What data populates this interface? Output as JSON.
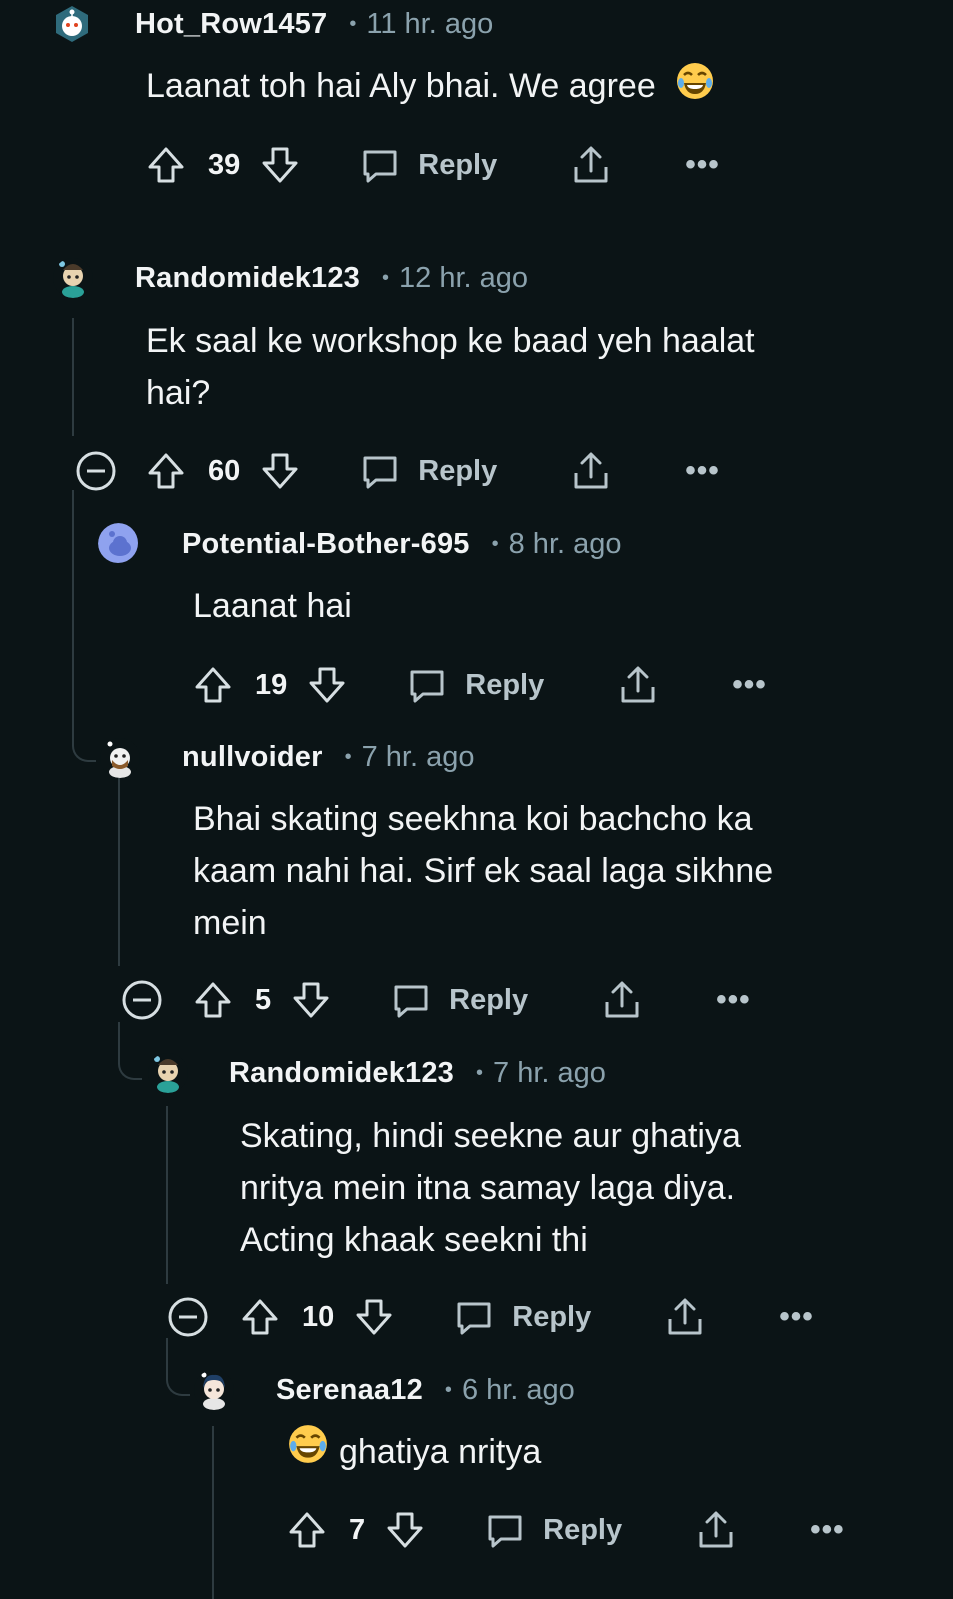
{
  "comments": [
    {
      "username": "Hot_Row1457",
      "time": "11 hr. ago",
      "lines": [
        "Laanat toh hai Aly bhai. We agree"
      ],
      "votes": "39",
      "reply_label": "Reply"
    },
    {
      "username": "Randomidek123",
      "time": "12 hr. ago",
      "lines": [
        "Ek saal ke workshop ke baad yeh haalat",
        "hai?"
      ],
      "votes": "60",
      "reply_label": "Reply"
    },
    {
      "username": "Potential-Bother-695",
      "time": "8 hr. ago",
      "lines": [
        "Laanat hai"
      ],
      "votes": "19",
      "reply_label": "Reply"
    },
    {
      "username": "nullvoider",
      "time": "7 hr. ago",
      "lines": [
        "Bhai skating seekhna koi bachcho ka",
        "kaam nahi hai. Sirf ek saal laga sikhne",
        "mein"
      ],
      "votes": "5",
      "reply_label": "Reply"
    },
    {
      "username": "Randomidek123",
      "time": "7 hr. ago",
      "lines": [
        "Skating, hindi seekne aur ghatiya",
        "nritya mein itna samay laga diya.",
        "Acting khaak seekni thi"
      ],
      "votes": "10",
      "reply_label": "Reply"
    },
    {
      "username": "Serenaa12",
      "time": "6 hr. ago",
      "lines": [
        "ghatiya nritya"
      ],
      "votes": "7",
      "reply_label": "Reply"
    }
  ],
  "meta_separator": "•",
  "more_label": "•••",
  "emoji_name": "face-with-tears-of-joy",
  "colors": {
    "background": "#0b1416",
    "text": "#f2f4f5",
    "muted": "#8ba2ad",
    "thread_line": "#2e3b40"
  }
}
